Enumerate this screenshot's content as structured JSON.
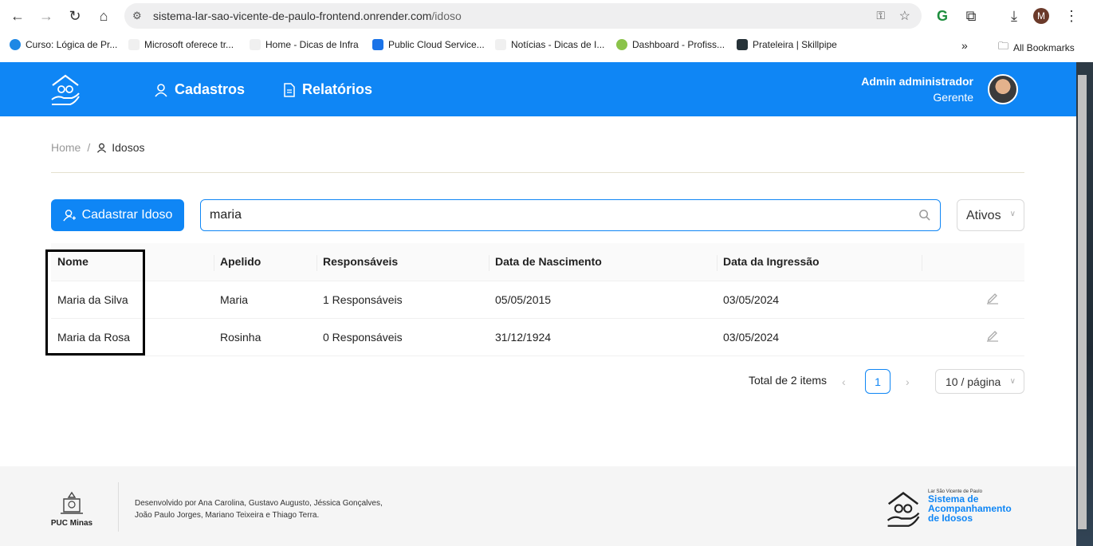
{
  "browser": {
    "url_domain": "sistema-lar-sao-vicente-de-paulo-frontend.onrender.com",
    "url_path": "/idoso",
    "profile_initial": "M",
    "bookmarks": [
      "Curso: Lógica de Pr...",
      "Microsoft oferece tr...",
      "Home - Dicas de Infra",
      "Public Cloud Service...",
      "Notícias - Dicas de I...",
      "Dashboard - Profiss...",
      "Prateleira | Skillpipe"
    ],
    "more_bookmarks": "»",
    "all_bookmarks": "All Bookmarks"
  },
  "header": {
    "menu": [
      "Cadastros",
      "Relatórios"
    ],
    "user_name": "Admin administrador",
    "user_role": "Gerente"
  },
  "breadcrumb": {
    "home": "Home",
    "separator": "/",
    "current": "Idosos"
  },
  "toolbar": {
    "add_label": "Cadastrar Idoso",
    "search_value": "maria",
    "status_filter": "Ativos"
  },
  "table": {
    "headers": [
      "Nome",
      "Apelido",
      "Responsáveis",
      "Data de Nascimento",
      "Data da Ingressão"
    ],
    "rows": [
      [
        "Maria da Silva",
        "Maria",
        "1 Responsáveis",
        "05/05/2015",
        "03/05/2024"
      ],
      [
        "Maria da Rosa",
        "Rosinha",
        "0 Responsáveis",
        "31/12/1924",
        "03/05/2024"
      ]
    ]
  },
  "pagination": {
    "total": "Total de 2 items",
    "current_page": "1",
    "page_size": "10 / página"
  },
  "footer": {
    "institution": "PUC Minas",
    "credits_line1": "Desenvolvido por Ana Carolina, Gustavo Augusto, Jéssica Gonçalves,",
    "credits_line2": "João Paulo Jorges, Mariano Teixeira e Thiago Terra.",
    "brand_small": "Lar São Vicente de Paulo",
    "brand_title": [
      "Sistema de",
      "Acompanhamento",
      "de Idosos"
    ]
  },
  "colors": {
    "primary": "#0f86f5"
  },
  "icons": [
    "back-icon",
    "forward-icon",
    "reload-icon",
    "home-icon",
    "site-settings-icon",
    "key-icon",
    "star-icon",
    "extension-icon",
    "download-icon",
    "menu-icon",
    "user-icon",
    "document-icon",
    "search-icon",
    "edit-icon",
    "chevron-down-icon",
    "folder-icon"
  ]
}
